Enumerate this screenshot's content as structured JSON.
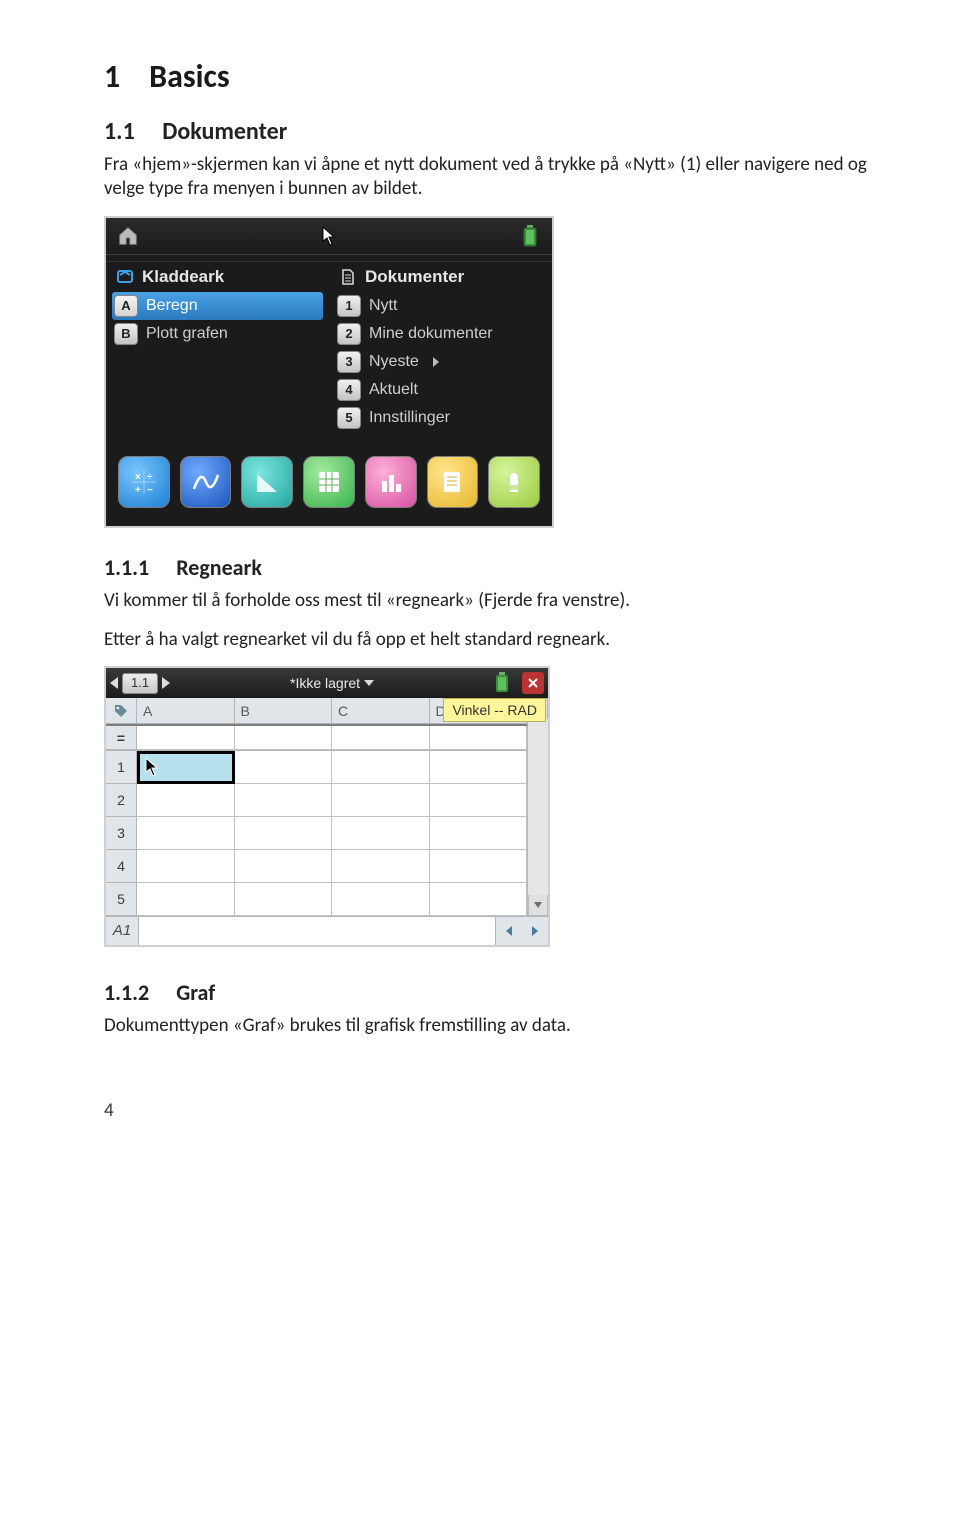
{
  "page_number": "4",
  "headings": {
    "h1_num": "1",
    "h1_text": "Basics",
    "h2_num": "1.1",
    "h2_text": "Dokumenter",
    "h3a_num": "1.1.1",
    "h3a_text": "Regneark",
    "h3b_num": "1.1.2",
    "h3b_text": "Graf"
  },
  "paragraphs": {
    "p1": "Fra «hjem»-skjermen kan vi åpne et nytt dokument ved å trykke på «Nytt» (1) eller navigere ned og velge type fra menyen i bunnen av bildet.",
    "p2": "Vi kommer til å forholde oss mest til «regneark» (Fjerde fra venstre).",
    "p3": "Etter å ha valgt regnearket vil du få opp et helt standard regneark.",
    "p4": "Dokumenttypen «Graf» brukes til grafisk fremstilling av data."
  },
  "shot1": {
    "left_header": "Kladdeark",
    "right_header": "Dokumenter",
    "left_items": [
      {
        "key": "A",
        "label": "Beregn",
        "selected": true
      },
      {
        "key": "B",
        "label": "Plott grafen",
        "selected": false
      }
    ],
    "right_items": [
      {
        "key": "1",
        "label": "Nytt"
      },
      {
        "key": "2",
        "label": "Mine dokumenter"
      },
      {
        "key": "3",
        "label": "Nyeste",
        "submenu": true
      },
      {
        "key": "4",
        "label": "Aktuelt"
      },
      {
        "key": "5",
        "label": "Innstillinger"
      }
    ],
    "apps": [
      {
        "name": "calculator-icon",
        "color": "blue"
      },
      {
        "name": "graph-icon",
        "color": "dblue"
      },
      {
        "name": "geometry-icon",
        "color": "teal"
      },
      {
        "name": "spreadsheet-icon",
        "color": "green"
      },
      {
        "name": "statistics-icon",
        "color": "pink"
      },
      {
        "name": "notes-icon",
        "color": "yellow"
      },
      {
        "name": "vernier-icon",
        "color": "lime"
      }
    ]
  },
  "shot2": {
    "tab_label": "1.1",
    "title": "*Ikke lagret",
    "tooltip": "Vinkel -- RAD",
    "columns": [
      "A",
      "B",
      "C",
      "D"
    ],
    "rows": [
      "1",
      "2",
      "3",
      "4",
      "5"
    ],
    "eq_label": "=",
    "cell_ref": "A1"
  }
}
